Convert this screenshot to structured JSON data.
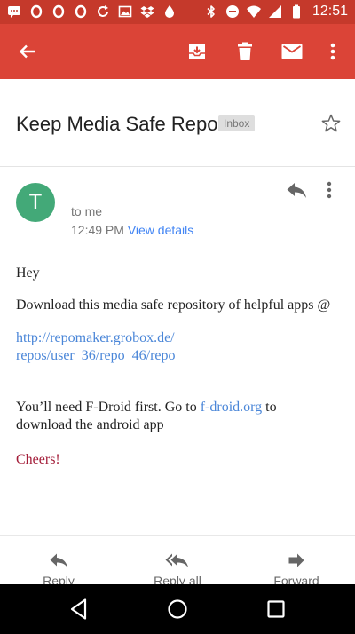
{
  "status_bar": {
    "time": "12:51",
    "notification_icons": [
      "chat-icon",
      "ring-icon",
      "ring-icon",
      "ring-icon",
      "refresh-icon",
      "image-icon",
      "dropbox-icon",
      "drop-icon"
    ],
    "system_icons": [
      "bluetooth-icon",
      "do-not-disturb-icon",
      "wifi-icon",
      "signal-icon",
      "battery-icon"
    ]
  },
  "app_bar": {
    "actions": [
      "back-arrow-icon",
      "archive-icon",
      "delete-icon",
      "mark-unread-icon",
      "more-icon"
    ]
  },
  "message": {
    "subject": "Keep Media Safe Repo",
    "label": "Inbox",
    "sender_initial": "T",
    "recipient": "to me",
    "time": "12:49 PM",
    "view_details": "View details",
    "body": {
      "greeting": "Hey",
      "line1": "Download this media safe repository of helpful apps @",
      "link_line1": "http://repomaker.grobox.de/",
      "link_line2": "repos/user_36/repo_46/repo",
      "fdroid_before": "You’ll need F-Droid first. Go to ",
      "fdroid_link": "f-droid.org",
      "fdroid_after": " to download the android app",
      "signoff": "Cheers!"
    }
  },
  "bottom_actions": {
    "reply": "Reply",
    "reply_all": "Reply all",
    "forward": "Forward"
  },
  "colors": {
    "status_bar": "#c5392b",
    "app_bar": "#db4437",
    "avatar": "#43a978",
    "link": "#4a86d8",
    "signoff": "#a31c38"
  }
}
